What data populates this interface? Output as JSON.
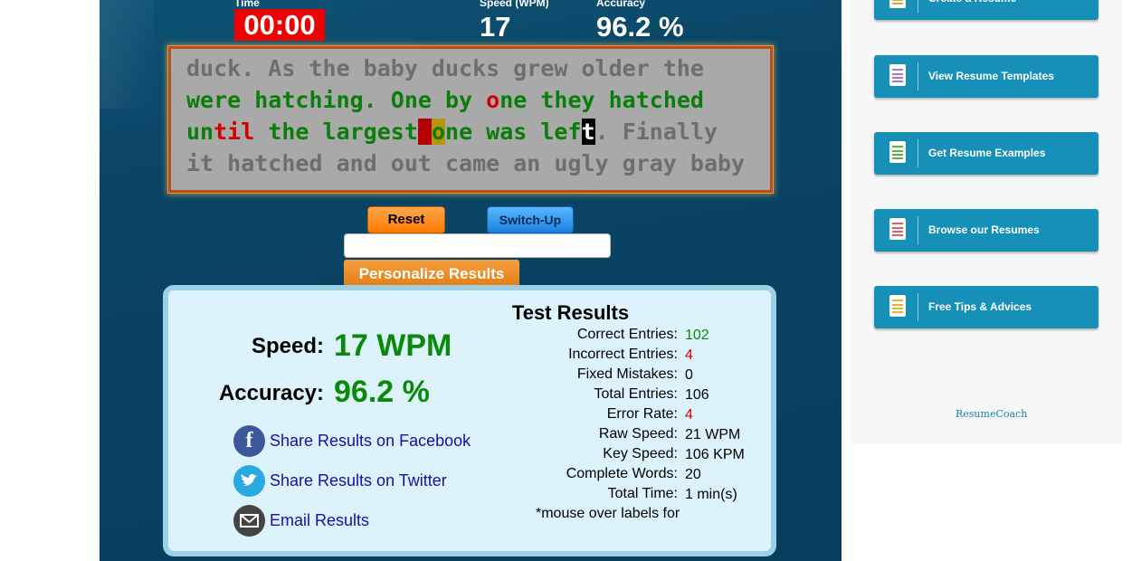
{
  "typing_test": {
    "time_label": "Time",
    "time_value": "00:00",
    "speed_label": "Speed (WPM)",
    "speed_value": "17",
    "accuracy_label": "Accuracy",
    "accuracy_value": "96.2 %",
    "text_lines": [
      "duck. As the baby ducks grew older the",
      "were hatching. One by one they hatched",
      "until the largest one was left. Finally",
      "it hatched and out came an ugly gray baby"
    ],
    "reset_label": "Reset",
    "switch_label": "Switch-Up",
    "input_value": "",
    "personalize_label": "Personalize Results"
  },
  "results": {
    "title": "Test Results",
    "speed_label": "Speed:",
    "speed_value": "17 WPM",
    "accuracy_label": "Accuracy:",
    "accuracy_value": "96.2 %",
    "share_facebook": "Share Results on Facebook",
    "share_twitter": "Share Results on Twitter",
    "share_email": "Email Results",
    "stats": [
      {
        "label": "Correct Entries:",
        "value": "102",
        "color": "green"
      },
      {
        "label": "Incorrect Entries:",
        "value": "4",
        "color": "red"
      },
      {
        "label": "Fixed Mistakes:",
        "value": "0",
        "color": "black"
      },
      {
        "label": "Total Entries:",
        "value": "106",
        "color": "black"
      },
      {
        "label": "Error Rate:",
        "value": "4",
        "color": "red"
      },
      {
        "label": "Raw Speed:",
        "value": "21 WPM",
        "color": "black"
      },
      {
        "label": "Key Speed:",
        "value": "106 KPM",
        "color": "black"
      },
      {
        "label": "Complete Words:",
        "value": "20",
        "color": "black"
      },
      {
        "label": "Total Time:",
        "value": "1 min(s)",
        "color": "black"
      }
    ],
    "mouse_note": "*mouse over labels for"
  },
  "sidebar": {
    "items": [
      {
        "label": "Create a Resume",
        "icon": "resume-doc-icon",
        "color": "#f0a030"
      },
      {
        "label": "View Resume Templates",
        "icon": "resume-doc-icon",
        "color": "#b070d0"
      },
      {
        "label": "Get Resume Examples",
        "icon": "resume-doc-icon",
        "color": "#60b040"
      },
      {
        "label": "Browse our Resumes",
        "icon": "resume-doc-icon",
        "color": "#e06060"
      },
      {
        "label": "Free Tips & Advices",
        "icon": "resume-doc-icon",
        "color": "#f0b030"
      }
    ],
    "brand": "ResumeCoach"
  },
  "colors": {
    "panel": "#0c4a6b",
    "timer_bg": "#ee0000",
    "correct": "#0a7d0a",
    "error": "#d40000",
    "sidebar_button": "#1690b8"
  }
}
